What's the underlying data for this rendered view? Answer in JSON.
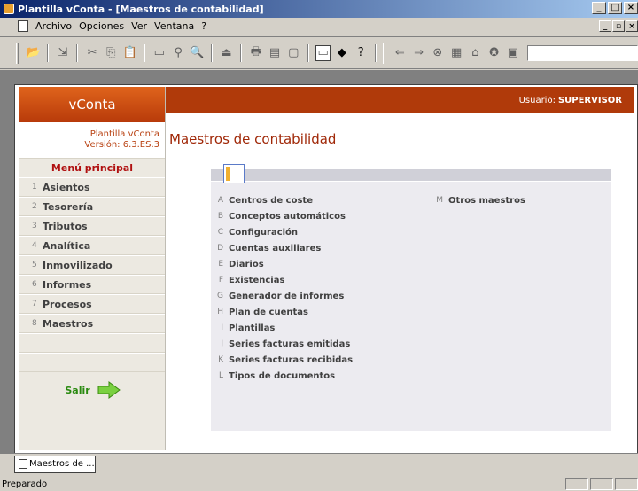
{
  "window": {
    "title": "Plantilla vConta - [Maestros de contabilidad]"
  },
  "menubar": {
    "items": [
      {
        "label": "Archivo",
        "hotkey": "A"
      },
      {
        "label": "Opciones",
        "hotkey": "O"
      },
      {
        "label": "Ver",
        "hotkey": "V"
      },
      {
        "label": "Ventana",
        "hotkey": "t"
      },
      {
        "label": "?",
        "hotkey": "?"
      }
    ]
  },
  "sidebar": {
    "header": "vConta",
    "info_line1": "Plantilla vConta",
    "info_line2": "Versión: 6.3.ES.3",
    "menu_title": "Menú principal",
    "items": [
      {
        "num": "1",
        "label": "Asientos"
      },
      {
        "num": "2",
        "label": "Tesorería"
      },
      {
        "num": "3",
        "label": "Tributos"
      },
      {
        "num": "4",
        "label": "Analítica"
      },
      {
        "num": "5",
        "label": "Inmovilizado"
      },
      {
        "num": "6",
        "label": "Informes"
      },
      {
        "num": "7",
        "label": "Procesos"
      },
      {
        "num": "8",
        "label": "Maestros"
      }
    ],
    "exit_label": "Salir"
  },
  "main": {
    "user_label": "Usuario:",
    "user_name": "SUPERVISOR",
    "page_title": "Maestros de contabilidad",
    "options_left": [
      {
        "key": "A",
        "label": "Centros de coste"
      },
      {
        "key": "B",
        "label": "Conceptos automáticos"
      },
      {
        "key": "C",
        "label": "Configuración"
      },
      {
        "key": "D",
        "label": "Cuentas auxiliares"
      },
      {
        "key": "E",
        "label": "Diarios"
      },
      {
        "key": "F",
        "label": "Existencias"
      },
      {
        "key": "G",
        "label": "Generador de informes"
      },
      {
        "key": "H",
        "label": "Plan de cuentas"
      },
      {
        "key": "I",
        "label": "Plantillas"
      },
      {
        "key": "J",
        "label": "Series facturas emitidas"
      },
      {
        "key": "K",
        "label": "Series facturas recibidas"
      },
      {
        "key": "L",
        "label": "Tipos de documentos"
      }
    ],
    "options_right": [
      {
        "key": "M",
        "label": "Otros maestros"
      }
    ]
  },
  "tabbar": {
    "tab_label": "Maestros de ..."
  },
  "statusbar": {
    "text": "Preparado"
  },
  "colors": {
    "accent": "#b03a0a",
    "title": "#a02808",
    "exit": "#2a8a10"
  }
}
